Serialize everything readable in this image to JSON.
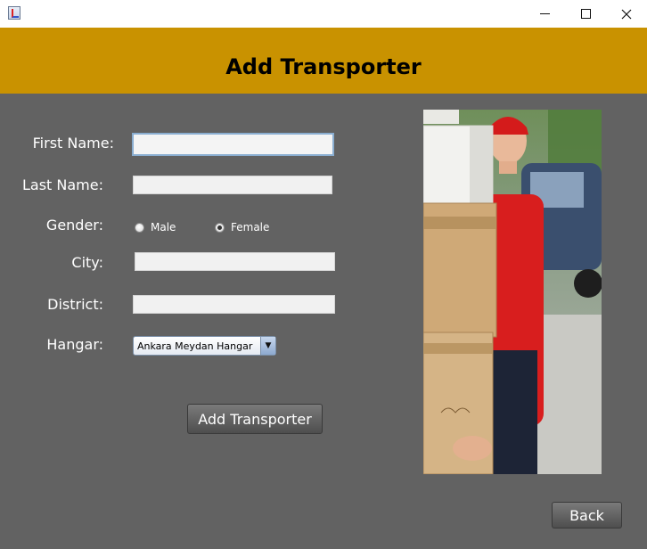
{
  "window": {
    "title": ""
  },
  "header": {
    "title": "Add Transporter"
  },
  "form": {
    "first_name": {
      "label": "First Name:",
      "value": ""
    },
    "last_name": {
      "label": "Last Name:",
      "value": ""
    },
    "gender": {
      "label": "Gender:",
      "options": [
        "Male",
        "Female"
      ],
      "selected": "Female"
    },
    "city": {
      "label": "City:",
      "value": ""
    },
    "district": {
      "label": "District:",
      "value": ""
    },
    "hangar": {
      "label": "Hangar:",
      "selected": "Ankara Meydan Hangar"
    }
  },
  "buttons": {
    "add_label": "Add Transporter",
    "back_label": "Back"
  },
  "image": {
    "subject": "delivery-man-with-boxes"
  },
  "colors": {
    "header_bg": "#c99200",
    "body_bg": "#626262",
    "label_text": "#ffffff"
  }
}
